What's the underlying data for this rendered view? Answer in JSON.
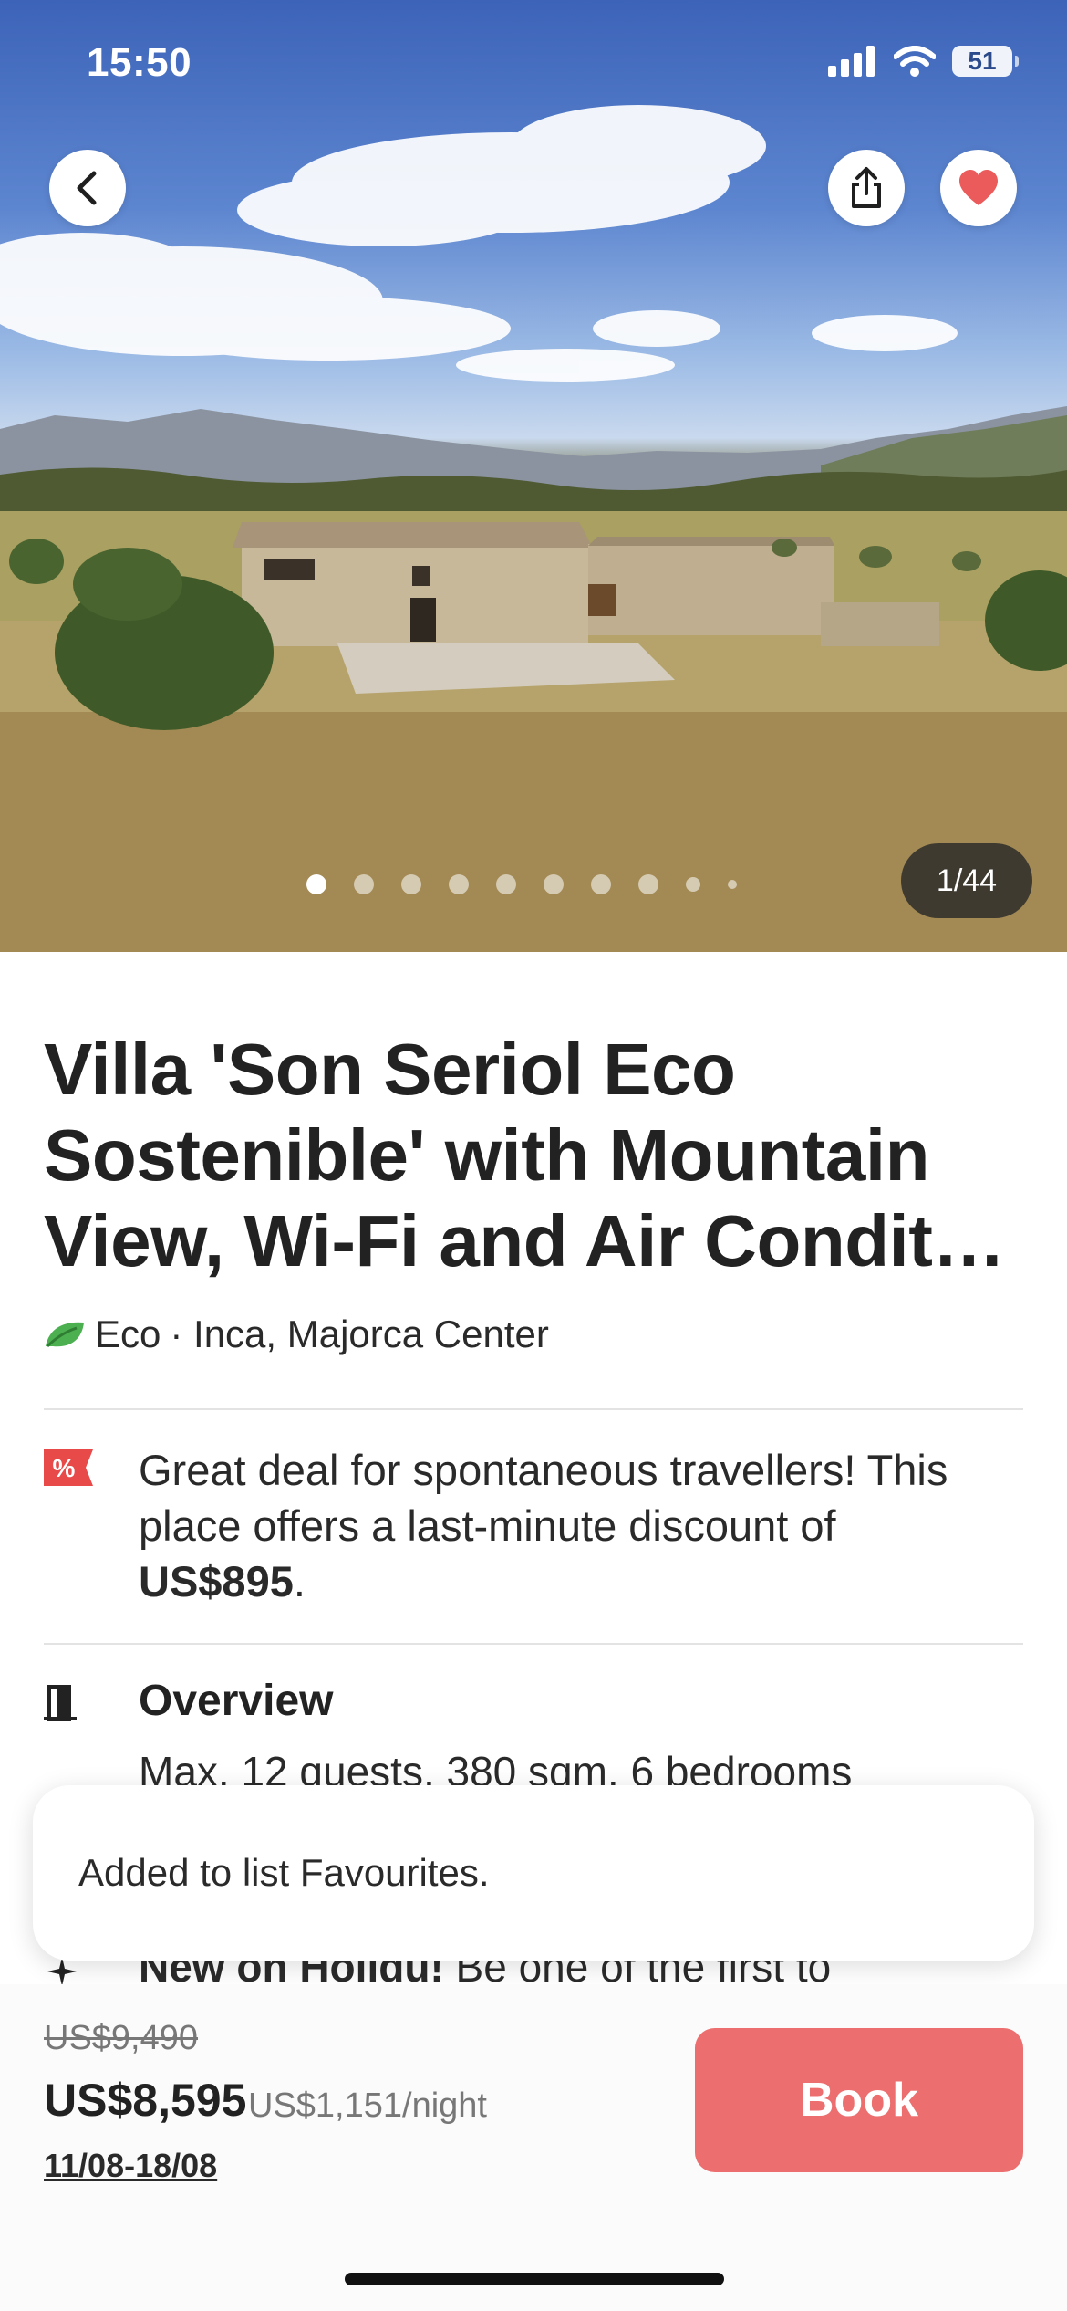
{
  "status_bar": {
    "time": "15:50",
    "battery": "51"
  },
  "hero": {
    "counter": "1/44",
    "dots_count": 10,
    "active_dot_index": 0
  },
  "listing": {
    "title": "Villa 'Son Seriol Eco Sostenible' with Mountain View, Wi-Fi and Air Condit…",
    "eco_label": "Eco",
    "location": " · Inca, Majorca Center"
  },
  "deal": {
    "text_before": "Great deal for spontaneous travellers! This place offers a last-minute discount of ",
    "amount": "US$895",
    "text_after": "."
  },
  "overview": {
    "title": "Overview",
    "text": "Max. 12 guests, 380 sqm, 6 bedrooms"
  },
  "new_on": {
    "bold": "New on Holidu!",
    "text": " Be one of the first to"
  },
  "toast": {
    "message": "Added to list Favourites."
  },
  "booking": {
    "old_price": "US$9,490",
    "price": "US$8,595",
    "per_night": "US$1,151/night",
    "dates": "11/08-18/08",
    "book_label": "Book"
  },
  "colors": {
    "accent": "#ec6e6e",
    "heart": "#ec5b5b",
    "eco_green": "#4caf50",
    "deal_red": "#e84a4a"
  }
}
